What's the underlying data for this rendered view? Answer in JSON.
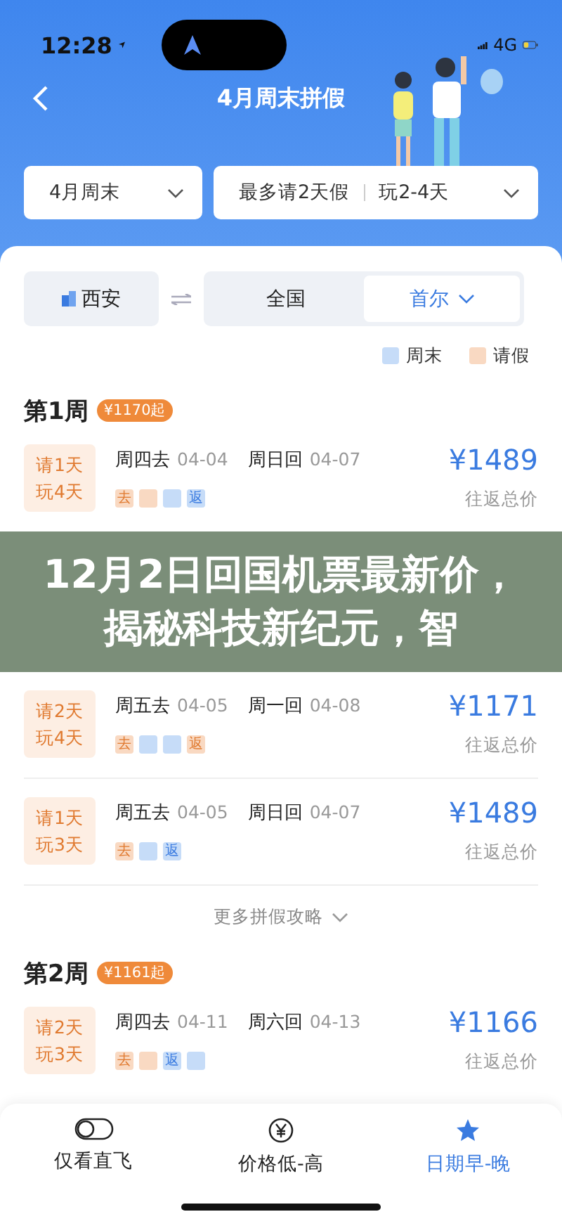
{
  "status_bar": {
    "time": "12:28",
    "network": "4G"
  },
  "nav": {
    "title": "4月周末拼假"
  },
  "filters": [
    {
      "label": "4月周末"
    },
    {
      "label": "最多请2天假",
      "label_2": "玩2-4天"
    }
  ],
  "route": {
    "origin": "西安",
    "destinations": [
      {
        "label": "全国",
        "selected": false
      },
      {
        "label": "首尔",
        "selected": true
      }
    ]
  },
  "legend": [
    {
      "kind": "weekend",
      "label": "周末"
    },
    {
      "kind": "leave",
      "label": "请假"
    }
  ],
  "weeks": [
    {
      "title": "第1周",
      "badge": "¥1170起",
      "trips": [
        {
          "leave": "请1天",
          "play": "玩4天",
          "depart_day": "周四去",
          "depart_date": "04-04",
          "return_day": "周日回",
          "return_date": "04-07",
          "price": "¥1489",
          "price_note": "往返总价",
          "days": [
            {
              "kind": "leave",
              "label": "去"
            },
            {
              "kind": "leave"
            },
            {
              "kind": "weekend"
            },
            {
              "kind": "weekend",
              "label": "返"
            }
          ]
        }
      ]
    },
    {
      "kind": "banner",
      "text": "12月2日回国机票最新价，揭秘科技新纪元，智"
    },
    {
      "trips": [
        {
          "leave": "请2天",
          "play": "玩4天",
          "depart_day": "周五去",
          "depart_date": "04-05",
          "return_day": "周一回",
          "return_date": "04-08",
          "price": "¥1171",
          "price_note": "往返总价",
          "days": [
            {
              "kind": "leave",
              "label": "去"
            },
            {
              "kind": "weekend"
            },
            {
              "kind": "weekend"
            },
            {
              "kind": "leave",
              "label": "返"
            }
          ]
        },
        {
          "leave": "请1天",
          "play": "玩3天",
          "depart_day": "周五去",
          "depart_date": "04-05",
          "return_day": "周日回",
          "return_date": "04-07",
          "price": "¥1489",
          "price_note": "往返总价",
          "days": [
            {
              "kind": "leave",
              "label": "去"
            },
            {
              "kind": "weekend"
            },
            {
              "kind": "weekend",
              "label": "返"
            }
          ]
        }
      ],
      "more": "更多拼假攻略"
    },
    {
      "title": "第2周",
      "badge": "¥1161起",
      "trips": [
        {
          "leave": "请2天",
          "play": "玩3天",
          "depart_day": "周四去",
          "depart_date": "04-11",
          "return_day": "周六回",
          "return_date": "04-13",
          "price": "¥1166",
          "price_note": "往返总价",
          "days": [
            {
              "kind": "leave",
              "label": "去"
            },
            {
              "kind": "leave"
            },
            {
              "kind": "weekend",
              "label": "返"
            },
            {
              "kind": "weekend"
            }
          ]
        }
      ]
    }
  ],
  "bottom_bar": [
    {
      "kind": "toggle",
      "label": "仅看直飞",
      "on": false,
      "selected": false
    },
    {
      "kind": "price",
      "label": "价格低-高",
      "selected": false
    },
    {
      "kind": "star",
      "label": "日期早-晚",
      "selected": true
    }
  ]
}
